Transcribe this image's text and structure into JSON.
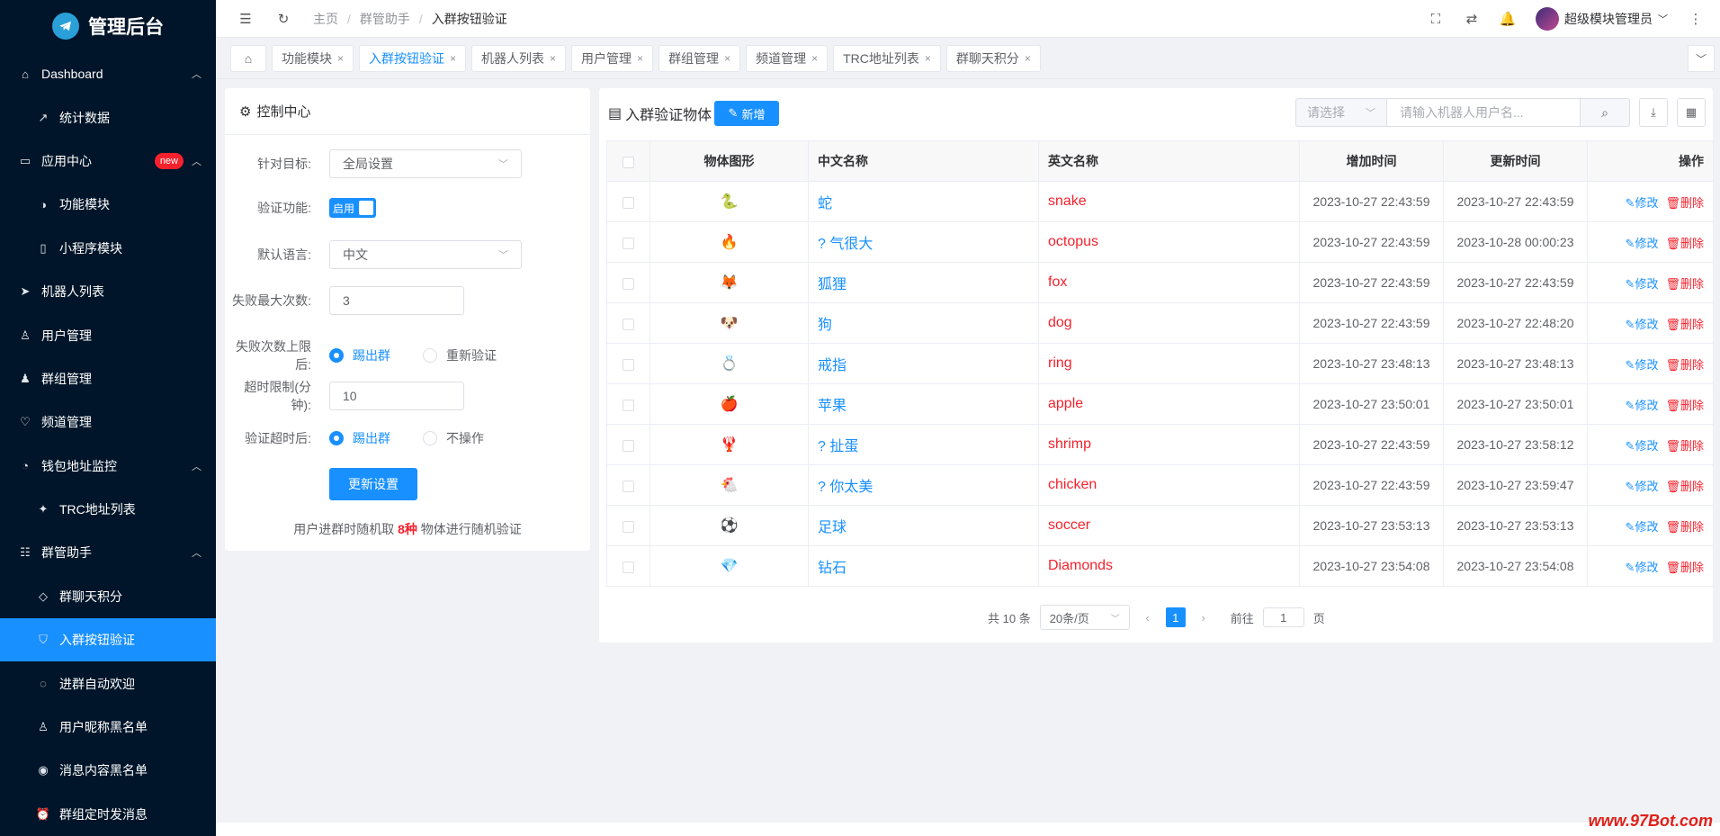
{
  "app": {
    "title": "管理后台"
  },
  "sidebar": {
    "items": [
      {
        "label": "Dashboard",
        "icon": "home-icon",
        "arrow": "⌃"
      },
      {
        "label": "统计数据",
        "icon": "trend-icon",
        "sub": true
      },
      {
        "label": "应用中心",
        "icon": "app-icon",
        "badge": "new",
        "arrow": "⌃"
      },
      {
        "label": "功能模块",
        "icon": "toggle-icon",
        "sub": true
      },
      {
        "label": "小程序模块",
        "icon": "phone-icon",
        "sub": true
      },
      {
        "label": "机器人列表",
        "icon": "send-icon"
      },
      {
        "label": "用户管理",
        "icon": "user-icon"
      },
      {
        "label": "群组管理",
        "icon": "users-icon"
      },
      {
        "label": "频道管理",
        "icon": "heart-icon"
      },
      {
        "label": "钱包地址监控",
        "icon": "stopwatch-icon",
        "arrow": "⌃"
      },
      {
        "label": "TRC地址列表",
        "icon": "bulb-icon",
        "sub": true
      },
      {
        "label": "群管助手",
        "icon": "group-tools-icon",
        "arrow": "⌃"
      },
      {
        "label": "群聊天积分",
        "icon": "diamond-icon",
        "sub": true
      },
      {
        "label": "入群按钮验证",
        "icon": "shield-icon",
        "sub": true,
        "active": true
      },
      {
        "label": "进群自动欢迎",
        "icon": "chat-icon",
        "sub": true
      },
      {
        "label": "用户昵称黑名单",
        "icon": "user-icon",
        "sub": true
      },
      {
        "label": "消息内容黑名单",
        "icon": "eye-icon",
        "sub": true
      },
      {
        "label": "群组定时发消息",
        "icon": "alarm-icon",
        "sub": true
      }
    ]
  },
  "header": {
    "breadcrumb": [
      "主页",
      "群管助手",
      "入群按钮验证"
    ],
    "user_name": "超级模块管理员"
  },
  "tabs": [
    {
      "label": "功能模块"
    },
    {
      "label": "入群按钮验证",
      "active": true
    },
    {
      "label": "机器人列表"
    },
    {
      "label": "用户管理"
    },
    {
      "label": "群组管理"
    },
    {
      "label": "频道管理"
    },
    {
      "label": "TRC地址列表"
    },
    {
      "label": "群聊天积分"
    }
  ],
  "control": {
    "title": "控制中心",
    "target_label": "针对目标:",
    "target_value": "全局设置",
    "verify_label": "验证功能:",
    "verify_switch": "启用",
    "lang_label": "默认语言:",
    "lang_value": "中文",
    "maxfail_label": "失败最大次数:",
    "maxfail_value": "3",
    "onlimit_label": "失败次数上限后:",
    "onlimit_opt1": "踢出群",
    "onlimit_opt2": "重新验证",
    "timeout_label": "超时限制(分钟):",
    "timeout_value": "10",
    "ontimeout_label": "验证超时后:",
    "ontimeout_opt1": "踢出群",
    "ontimeout_opt2": "不操作",
    "submit": "更新设置",
    "note_prefix": "用户进群时随机取",
    "note_count": "8种",
    "note_suffix": "物体进行随机验证"
  },
  "objects": {
    "title": "入群验证物体",
    "add_label": "新增",
    "select_placeholder": "请选择",
    "search_placeholder": "请输入机器人用户名...",
    "columns": [
      "物体图形",
      "中文名称",
      "英文名称",
      "增加时间",
      "更新时间",
      "操作"
    ],
    "edit_label": "修改",
    "delete_label": "删除",
    "rows": [
      {
        "icon": "🐍",
        "cn": "蛇",
        "en": "snake",
        "added": "2023-10-27 22:43:59",
        "updated": "2023-10-27 22:43:59"
      },
      {
        "icon": "🔥",
        "cn": "? 气很大",
        "en": "octopus",
        "added": "2023-10-27 22:43:59",
        "updated": "2023-10-28 00:00:23"
      },
      {
        "icon": "🦊",
        "cn": "狐狸",
        "en": "fox",
        "added": "2023-10-27 22:43:59",
        "updated": "2023-10-27 22:43:59"
      },
      {
        "icon": "🐶",
        "cn": "狗",
        "en": "dog",
        "added": "2023-10-27 22:43:59",
        "updated": "2023-10-27 22:48:20"
      },
      {
        "icon": "💍",
        "cn": "戒指",
        "en": "ring",
        "added": "2023-10-27 23:48:13",
        "updated": "2023-10-27 23:48:13"
      },
      {
        "icon": "🍎",
        "cn": "苹果",
        "en": "apple",
        "added": "2023-10-27 23:50:01",
        "updated": "2023-10-27 23:50:01"
      },
      {
        "icon": "🦞",
        "cn": "? 扯蛋",
        "en": "shrimp",
        "added": "2023-10-27 22:43:59",
        "updated": "2023-10-27 23:58:12"
      },
      {
        "icon": "🐔",
        "cn": "? 你太美",
        "en": "chicken",
        "added": "2023-10-27 22:43:59",
        "updated": "2023-10-27 23:59:47"
      },
      {
        "icon": "⚽",
        "cn": "足球",
        "en": "soccer",
        "added": "2023-10-27 23:53:13",
        "updated": "2023-10-27 23:53:13"
      },
      {
        "icon": "💎",
        "cn": "钻石",
        "en": "Diamonds",
        "added": "2023-10-27 23:54:08",
        "updated": "2023-10-27 23:54:08"
      }
    ]
  },
  "pager": {
    "total": "共 10 条",
    "size": "20条/页",
    "current": "1",
    "goto_label": "前往",
    "goto_value": "1",
    "page_label": "页"
  },
  "watermark": "www.97Bot.com",
  "colors": {
    "primary": "#1890ff",
    "danger": "#f5222d",
    "sidebar": "#001529"
  }
}
